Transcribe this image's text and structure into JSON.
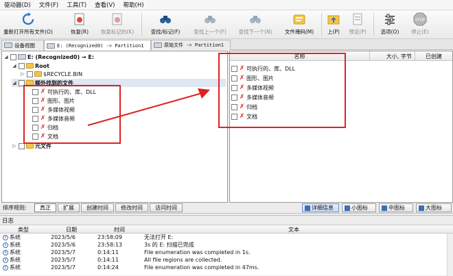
{
  "menu": [
    "驱动器(D)",
    "文件(F)",
    "工具(T)",
    "查看(V)",
    "帮助(H)"
  ],
  "toolbar": {
    "buttons": [
      {
        "label": "重新打开所有文件(O)",
        "icon": "refresh-icon",
        "enabled": true
      },
      {
        "label": "恢复(R)",
        "icon": "recover-icon",
        "enabled": true
      },
      {
        "label": "恢复标记的(K)",
        "icon": "recover-marked-icon",
        "enabled": false
      },
      {
        "label": "查找/标记(F)",
        "icon": "binoculars-icon",
        "enabled": true
      },
      {
        "label": "查找上一个(F)",
        "icon": "find-prev-icon",
        "enabled": false
      },
      {
        "label": "查找下一个(N)",
        "icon": "find-next-icon",
        "enabled": false
      },
      {
        "label": "文件掩码(M)",
        "icon": "file-mask-icon",
        "enabled": true
      },
      {
        "label": "上(P)",
        "icon": "folder-up-icon",
        "enabled": true
      },
      {
        "label": "预览(P)",
        "icon": "preview-icon",
        "enabled": false
      },
      {
        "label": "选项(O)",
        "icon": "options-icon",
        "enabled": true
      },
      {
        "label": "停止(E)",
        "icon": "stop-icon",
        "enabled": false
      }
    ]
  },
  "tabs": [
    {
      "label": "设备视图"
    },
    {
      "label": "E: (Recognized0) -> Partition1"
    },
    {
      "label": "原始文件 -> Partition1"
    }
  ],
  "tree": {
    "root_label": "E: (Recognized0) → E:",
    "root_folder": "Root",
    "recycle_bin": "$RECYCLE.BIN",
    "extra_found": "额外找到的文件",
    "categories": [
      "可执行的、库、DLL",
      "图形、图片",
      "多媒体视频",
      "多媒体音频",
      "归档",
      "文档"
    ],
    "no_file": "元文件"
  },
  "list": {
    "columns": [
      "名称",
      "大小, 字节",
      "已创建"
    ],
    "items": [
      "可执行的、库、DLL",
      "图形、图片",
      "多媒体视频",
      "多媒体音频",
      "归档",
      "文档"
    ]
  },
  "sortbar": {
    "label": "排序规则:",
    "buttons": [
      "真正",
      "扩展",
      "创建时间",
      "修改时间",
      "访问时间"
    ],
    "views": [
      "详细信息",
      "小图标",
      "中图标",
      "大图标"
    ]
  },
  "log": {
    "title": "日志",
    "columns": [
      "类型",
      "日期",
      "时间",
      "文本"
    ],
    "rows": [
      {
        "type": "系统",
        "date": "2023/5/6",
        "time": "23:58:09",
        "text": "无法打开 E:"
      },
      {
        "type": "系统",
        "date": "2023/5/6",
        "time": "23:58:13",
        "text": "3s 的 E: 扫描已完成"
      },
      {
        "type": "系统",
        "date": "2023/5/7",
        "time": "0:14:11",
        "text": "File enumeration was completed in 1s."
      },
      {
        "type": "系统",
        "date": "2023/5/7",
        "time": "0:14:11",
        "text": "All file regions are collected."
      },
      {
        "type": "系统",
        "date": "2023/5/7",
        "time": "0:14:24",
        "text": "File enumeration was completed in 47ms."
      }
    ]
  },
  "colors": {
    "annotation": "#e02020",
    "folder": "#f3c54a",
    "missing": "#d9261c"
  }
}
